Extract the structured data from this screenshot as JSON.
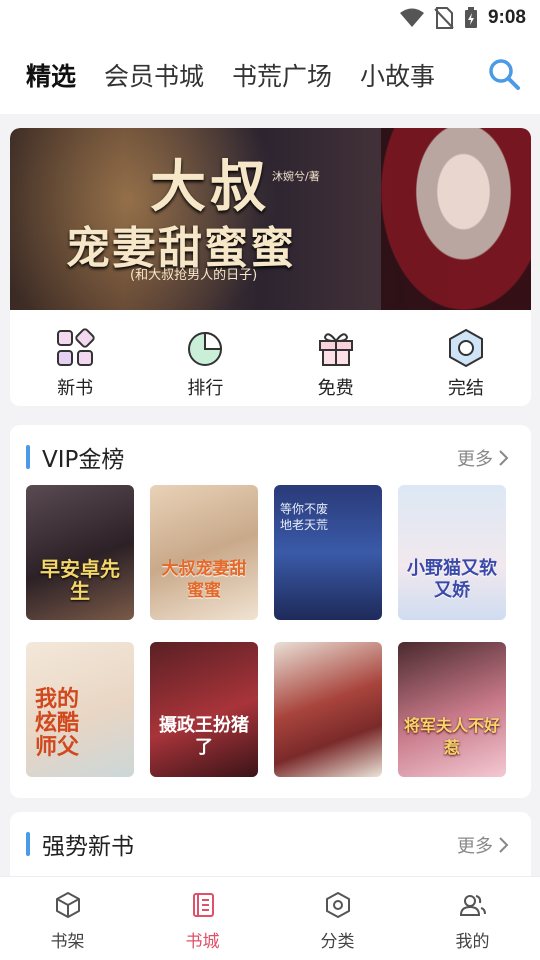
{
  "status": {
    "time": "9:08"
  },
  "top_tabs": [
    "精选",
    "会员书城",
    "书荒广场",
    "小故事"
  ],
  "banner": {
    "title_line1": "大叔",
    "title_line2": "宠妻甜蜜蜜",
    "subtitle": "(和大叔抢男人的日子)",
    "author": "沐婉兮/著"
  },
  "quick_links": [
    "新书",
    "排行",
    "免费",
    "完结"
  ],
  "vip": {
    "title": "VIP金榜",
    "more": "更多",
    "books": [
      {
        "text": "早安卓先生"
      },
      {
        "text": "大叔宠妻甜蜜蜜"
      },
      {
        "text": "等你不废地老天荒"
      },
      {
        "text": "小野猫又软又娇"
      },
      {
        "text": "我的炫酷师父"
      },
      {
        "text": "摄政王扮猪了"
      },
      {
        "text": ""
      },
      {
        "text": "将军夫人不好惹"
      }
    ]
  },
  "strong_new": {
    "title": "强势新书",
    "more": "更多"
  },
  "bottom_nav": [
    "书架",
    "书城",
    "分类",
    "我的"
  ],
  "colors": {
    "accent": "#4a9ae6",
    "active_nav": "#e0506a"
  }
}
